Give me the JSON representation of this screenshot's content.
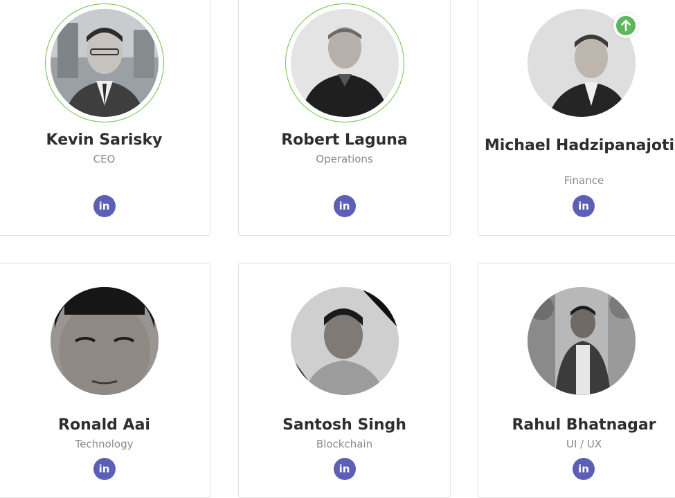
{
  "team": [
    {
      "name": "Kevin Sarisky",
      "role": "CEO",
      "linkedin_label": "in",
      "photo_icon": "portrait-photo"
    },
    {
      "name": "Robert Laguna",
      "role": "Operations",
      "linkedin_label": "in",
      "photo_icon": "portrait-photo"
    },
    {
      "name": "Michael Hadzipanajotis",
      "role": "Finance",
      "linkedin_label": "in",
      "photo_icon": "portrait-photo"
    },
    {
      "name": "Ronald Aai",
      "role": "Technology",
      "linkedin_label": "in",
      "photo_icon": "portrait-photo"
    },
    {
      "name": "Santosh Singh",
      "role": "Blockchain",
      "linkedin_label": "in",
      "photo_icon": "portrait-photo"
    },
    {
      "name": "Rahul Bhatnagar",
      "role": "UI / UX",
      "linkedin_label": "in",
      "photo_icon": "portrait-photo"
    }
  ],
  "scroll_top": {
    "icon": "arrow-up-icon"
  },
  "colors": {
    "ring": "#6cc24a",
    "linkedin": "#5b5fb5",
    "scroll_top": "#5cb85c",
    "name": "#2e2e2e",
    "role": "#8a8a8a"
  }
}
